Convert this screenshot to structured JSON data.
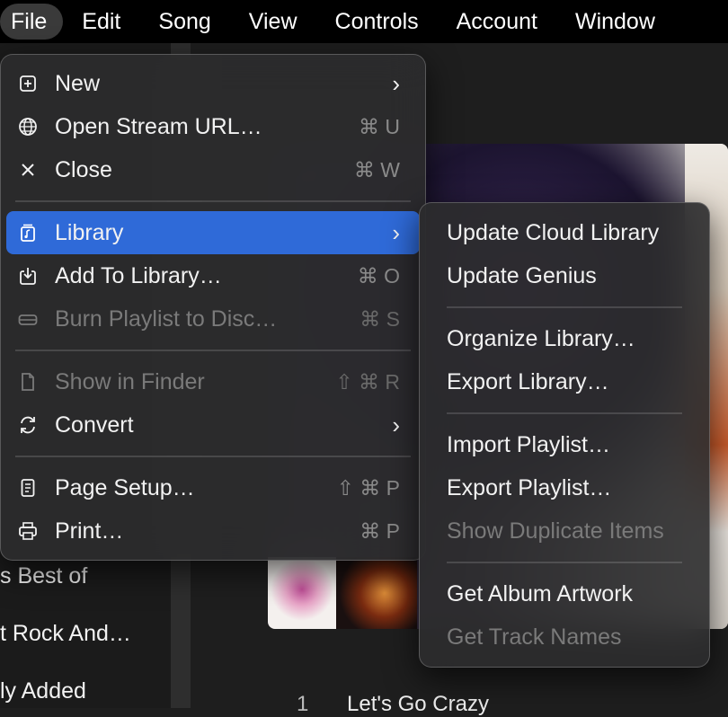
{
  "menubar": {
    "items": [
      "File",
      "Edit",
      "Song",
      "View",
      "Controls",
      "Account",
      "Window"
    ]
  },
  "file_menu": {
    "items": [
      {
        "label": "New",
        "icon": "plus-square-icon",
        "shortcut": "",
        "submenu": true,
        "disabled": false
      },
      {
        "label": "Open Stream URL…",
        "icon": "globe-icon",
        "shortcut": "⌘ U",
        "submenu": false,
        "disabled": false
      },
      {
        "label": "Close",
        "icon": "close-icon",
        "shortcut": "⌘ W",
        "submenu": false,
        "disabled": false
      },
      {
        "label": "Library",
        "icon": "library-icon",
        "shortcut": "",
        "submenu": true,
        "disabled": false,
        "highlighted": true
      },
      {
        "label": "Add To Library…",
        "icon": "download-tray-icon",
        "shortcut": "⌘ O",
        "submenu": false,
        "disabled": false
      },
      {
        "label": "Burn Playlist to Disc…",
        "icon": "disc-drive-icon",
        "shortcut": "⌘ S",
        "submenu": false,
        "disabled": true
      },
      {
        "label": "Show in Finder",
        "icon": "document-icon",
        "shortcut": "⇧ ⌘ R",
        "submenu": false,
        "disabled": true
      },
      {
        "label": "Convert",
        "icon": "convert-arrows-icon",
        "shortcut": "",
        "submenu": true,
        "disabled": false
      },
      {
        "label": "Page Setup…",
        "icon": "page-icon",
        "shortcut": "⇧ ⌘ P",
        "submenu": false,
        "disabled": false
      },
      {
        "label": "Print…",
        "icon": "printer-icon",
        "shortcut": "⌘ P",
        "submenu": false,
        "disabled": false
      }
    ]
  },
  "library_menu": {
    "items": [
      {
        "label": "Update Cloud Library",
        "disabled": false
      },
      {
        "label": "Update Genius",
        "disabled": false
      },
      {
        "label": "Organize Library…",
        "disabled": false
      },
      {
        "label": "Export Library…",
        "disabled": false
      },
      {
        "label": "Import Playlist…",
        "disabled": false
      },
      {
        "label": "Export Playlist…",
        "disabled": false
      },
      {
        "label": "Show Duplicate Items",
        "disabled": true
      },
      {
        "label": "Get Album Artwork",
        "disabled": false
      },
      {
        "label": "Get Track Names",
        "disabled": true
      }
    ]
  },
  "sidebar": {
    "items": [
      "s Best of",
      "t Rock And…",
      "ly Added"
    ]
  },
  "tracklist": {
    "rows": [
      {
        "number": "1",
        "title": "Let's Go Crazy"
      }
    ]
  },
  "colors": {
    "highlight": "#2f6ad8",
    "menu_bg": "#2c2c2e",
    "disabled_text": "#7a7a7a"
  }
}
